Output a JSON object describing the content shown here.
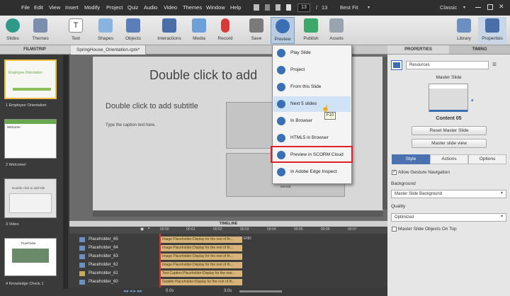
{
  "menubar": {
    "items": [
      "File",
      "Edit",
      "View",
      "Insert",
      "Modify",
      "Project",
      "Quiz",
      "Audio",
      "Video",
      "Themes",
      "Window",
      "Help"
    ],
    "page_current": "13",
    "page_total": "13",
    "zoom": "Best Fit",
    "workspace": "Classic"
  },
  "toolbar": {
    "left": [
      "Slides",
      "Themes",
      "Text",
      "Shapes",
      "Objects",
      "Interactions",
      "Media",
      "Record",
      "Save",
      "Preview",
      "Publish",
      "Assets"
    ],
    "right": [
      "Library",
      "Properties"
    ]
  },
  "filmstrip": {
    "title": "FILMSTRIP",
    "slides": [
      {
        "label": "1 Employee Orientation",
        "thumb_title": "Employee Orientation"
      },
      {
        "label": "2 Welcome!",
        "thumb_title": "Welcome"
      },
      {
        "label": "3 Video",
        "thumb_title": "Double click to add title"
      },
      {
        "label": "4 Knowledge Check 1",
        "thumb_title": "True/False"
      }
    ]
  },
  "document": {
    "tab": "SpringHouse_Orientation.cptx*",
    "title_placeholder": "Double click to add",
    "subtitle_placeholder": "Double click to add subtitle",
    "caption_placeholder": "Type the caption text here.",
    "image_label": "IMAGE"
  },
  "preview_menu": {
    "items": [
      {
        "label": "Play Slide",
        "highlight": false
      },
      {
        "label": "Project",
        "highlight": false
      },
      {
        "label": "From this Slide",
        "highlight": false
      },
      {
        "label": "Next 5 slides",
        "highlight": true
      },
      {
        "label": "In Browser",
        "highlight": false
      },
      {
        "label": "HTML5 in Browser",
        "highlight": false
      },
      {
        "label": "Preview in SCORM Cloud",
        "highlight": false
      },
      {
        "label": "In Adobe Edge Inspect",
        "highlight": false
      }
    ],
    "tooltip": "F10",
    "annotation_color": "#e0202a"
  },
  "timeline": {
    "title": "TIMELINE",
    "ticks": [
      "00:00",
      "00:01",
      "00:02",
      "00:03",
      "00:04",
      "00:05",
      "00:06",
      "00:07"
    ],
    "end_label": "END",
    "rows": [
      {
        "name": "Placeholder_65",
        "bar": "Image Placeholder:Display for the rest of th..."
      },
      {
        "name": "Placeholder_64",
        "bar": "Image Placeholder:Display for the rest of th..."
      },
      {
        "name": "Placeholder_63",
        "bar": "Image Placeholder:Display for the rest of th..."
      },
      {
        "name": "Placeholder_62",
        "bar": "Image Placeholder:Display for the rest of th..."
      },
      {
        "name": "Placeholder_61",
        "bar": "Text Caption Placeholder:Display for the rest..."
      },
      {
        "name": "Placeholder_60",
        "bar": "Subtitle Placeholder:Display for the rest of th..."
      }
    ],
    "footer_time1": "0.0s",
    "footer_time2": "3.0s"
  },
  "properties": {
    "tab_properties": "PROPERTIES",
    "tab_timing": "TIMING",
    "name_field": "Resources",
    "master_slide_label": "Master Slide",
    "master_name": "Content 05",
    "reset_btn": "Reset Master Slide",
    "view_btn": "Master slide view",
    "subtabs": [
      "Style",
      "Actions",
      "Options"
    ],
    "gesture_label": "Allow Gesture Navigation",
    "background_label": "Background",
    "background_value": "Master Slide Background",
    "quality_label": "Quality",
    "quality_value": "Optimized",
    "master_on_top_label": "Master Slide Objects On Top",
    "accent": "#3b6fb4"
  }
}
